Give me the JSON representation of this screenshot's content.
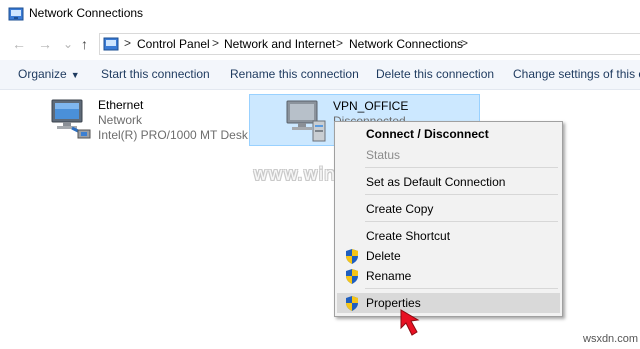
{
  "window": {
    "title": "Network Connections",
    "icon": "network-connections-icon"
  },
  "navigation": {
    "back_icon": "←",
    "forward_icon": "→",
    "recent_icon": "⌄",
    "up_icon": "↑",
    "breadcrumbs": [
      "Control Panel",
      "Network and Internet",
      "Network Connections"
    ],
    "separator": ">"
  },
  "commandbar": {
    "organize": "Organize",
    "start": "Start this connection",
    "rename": "Rename this connection",
    "delete": "Delete this connection",
    "change": "Change settings of this co"
  },
  "connections": [
    {
      "name": "Ethernet",
      "type": "Network",
      "device": "Intel(R) PRO/1000 MT Desk...",
      "icon": "ethernet-adapter-icon",
      "selected": false
    },
    {
      "name": "VPN_OFFICE",
      "status": "Disconnected",
      "icon": "vpn-connection-icon",
      "selected": true
    }
  ],
  "context_menu": {
    "connect": "Connect / Disconnect",
    "status": "Status",
    "set_default": "Set as Default Connection",
    "create_copy": "Create Copy",
    "create_shortcut": "Create Shortcut",
    "delete": "Delete",
    "rename": "Rename",
    "properties": "Properties"
  },
  "watermark": "www.wintips.org",
  "site_mark": "wsxdn.com",
  "colors": {
    "selection": "#cce8ff",
    "selection_border": "#99d1ff",
    "commandbar": "#f3f6fb",
    "cursor": "#e81123"
  }
}
